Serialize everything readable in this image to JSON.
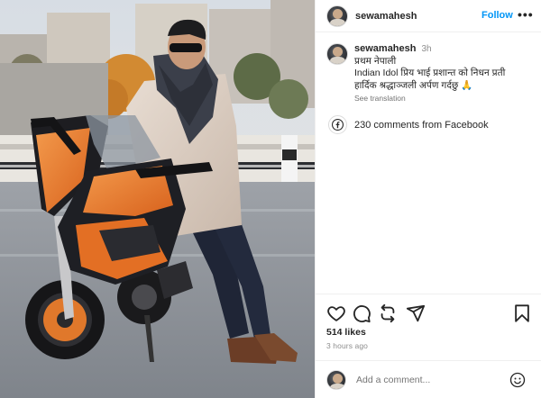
{
  "post": {
    "username": "sewamahesh",
    "follow_label": "Follow",
    "more_label": "•••",
    "caption": {
      "username": "sewamahesh",
      "time": "3h",
      "line1": "प्रथम नेपाली",
      "line2": "Indian Idol प्रिय भाई प्रशान्त को निधन प्रती",
      "line3": "हार्दिक श्रद्धाञ्जली अर्पण गर्दछु 🙏",
      "see_translation": "See translation"
    },
    "facebook_comments": "230 comments from Facebook",
    "likes": "514 likes",
    "time_ago": "3 hours ago",
    "comment_placeholder": "Add a comment..."
  },
  "icons": {
    "like": "heart-icon",
    "comment": "comment-bubble-icon",
    "repost": "repost-icon",
    "share": "paper-plane-icon",
    "save": "bookmark-icon",
    "facebook": "facebook-icon",
    "emoji": "emoji-smiley-icon"
  },
  "colors": {
    "accent": "#0095f6",
    "text": "#262626",
    "muted": "#8e8e8e",
    "border": "#efefef"
  }
}
